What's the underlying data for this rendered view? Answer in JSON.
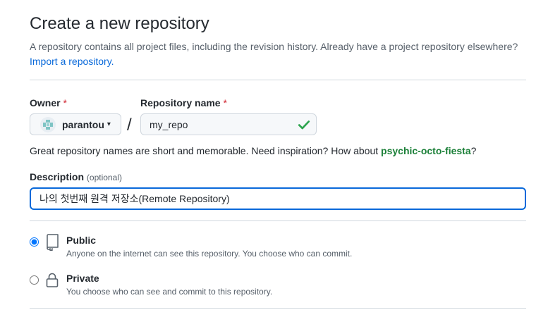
{
  "page": {
    "title": "Create a new repository",
    "subtitle": "A repository contains all project files, including the revision history. Already have a project repository elsewhere?",
    "import_link": "Import a repository."
  },
  "owner": {
    "label": "Owner",
    "required_mark": "*",
    "name": "parantou",
    "caret_icon": "triangle-down-icon",
    "avatar_icon": "identicon-avatar"
  },
  "separator": "/",
  "repo_name": {
    "label": "Repository name",
    "required_mark": "*",
    "value": "my_repo",
    "valid_icon": "check-icon"
  },
  "hint": {
    "text": "Great repository names are short and memorable. Need inspiration? How about ",
    "suggestion": "psychic-octo-fiesta",
    "end": "?"
  },
  "description": {
    "label": "Description",
    "optional": "(optional)",
    "value": "나의 첫번째 원격 저장소(Remote Repository)"
  },
  "visibility": [
    {
      "title": "Public",
      "desc": "Anyone on the internet can see this repository. You choose who can commit.",
      "selected": true,
      "icon": "repo-icon"
    },
    {
      "title": "Private",
      "desc": "You choose who can see and commit to this repository.",
      "selected": false,
      "icon": "lock-icon"
    }
  ],
  "colors": {
    "accent": "#0969da",
    "success": "#1a7f37",
    "danger": "#cf222e"
  }
}
